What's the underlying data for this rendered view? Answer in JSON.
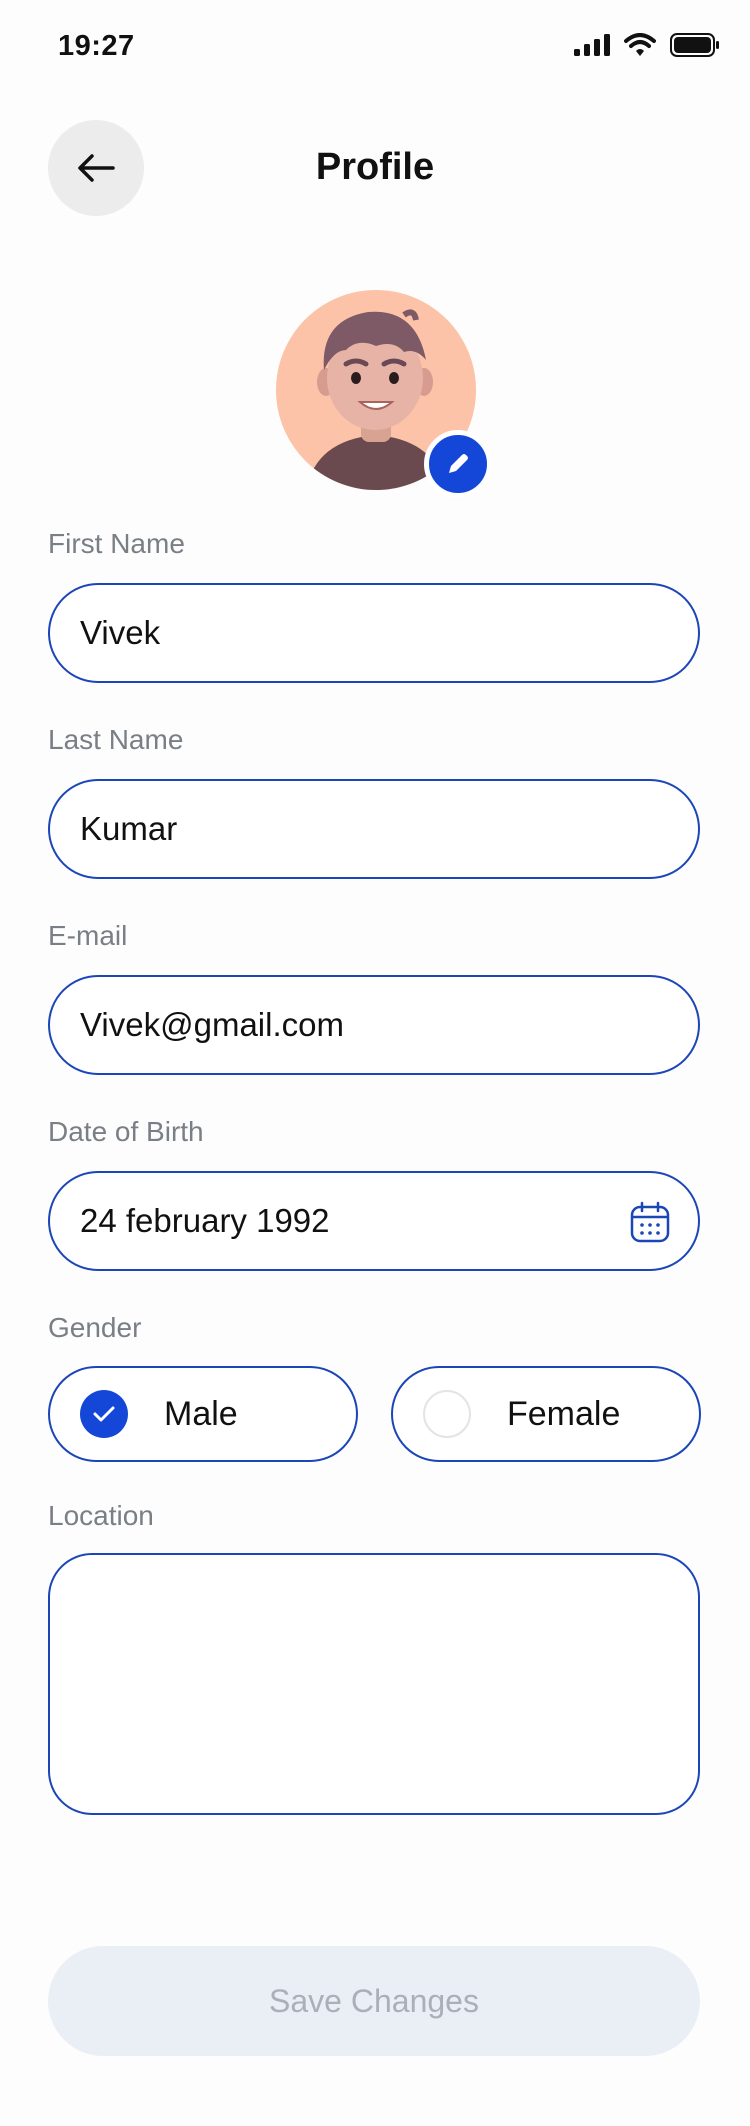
{
  "status_bar": {
    "time": "19:27",
    "icons": [
      "cellular-signal-icon",
      "wifi-icon",
      "battery-icon"
    ]
  },
  "header": {
    "back_icon": "arrow-left-icon",
    "title": "Profile"
  },
  "avatar": {
    "edit_icon": "pencil-icon"
  },
  "form": {
    "first_name": {
      "label": "First Name",
      "value": "Vivek"
    },
    "last_name": {
      "label": "Last Name",
      "value": "Kumar"
    },
    "email": {
      "label": "E-mail",
      "value": "Vivek@gmail.com"
    },
    "dob": {
      "label": "Date of Birth",
      "value": "24 february 1992",
      "icon": "calendar-icon"
    },
    "gender": {
      "label": "Gender",
      "options": [
        {
          "label": "Male",
          "selected": true
        },
        {
          "label": "Female",
          "selected": false
        }
      ]
    },
    "location": {
      "label": "Location",
      "value": ""
    }
  },
  "actions": {
    "save_label": "Save Changes"
  },
  "colors": {
    "accent": "#1447d8",
    "field_border": "#1b46b8",
    "avatar_bg": "#fcc3a8",
    "save_bg": "#eaeff5",
    "save_text": "#aab0b8",
    "label_text": "#7a7e85"
  }
}
